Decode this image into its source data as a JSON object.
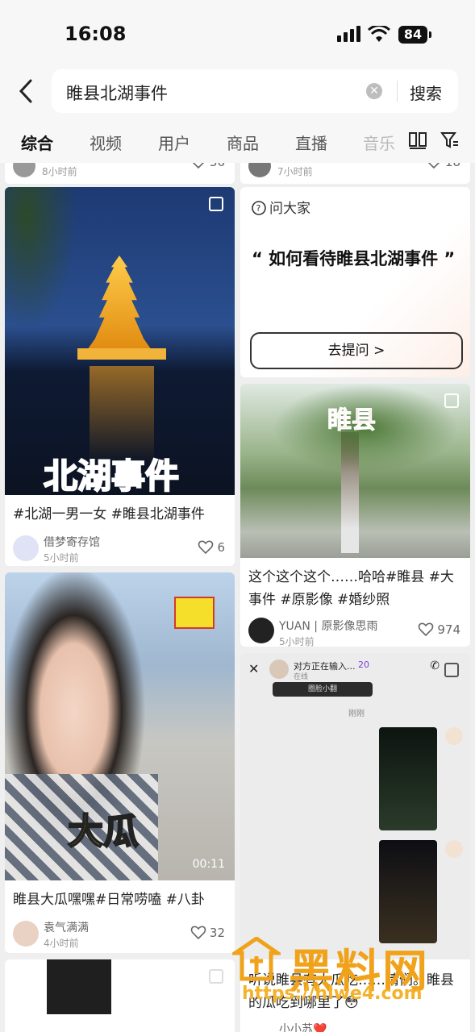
{
  "status": {
    "time": "16:08",
    "battery": "84"
  },
  "header": {
    "query": "睢县北湖事件",
    "search_label": "搜索"
  },
  "tabs": [
    "综合",
    "视频",
    "用户",
    "商品",
    "直播",
    "音乐"
  ],
  "top_row": {
    "left_time": "8小时前",
    "left_likes": "36",
    "right_time": "7小时前",
    "right_likes": "18"
  },
  "card1": {
    "overlay": "北湖事件",
    "desc": "#北湖一男一女 #睢县北湖事件",
    "author": "借梦寄存馆",
    "time": "5小时前",
    "likes": "6"
  },
  "ask": {
    "label": "问大家",
    "question": "“ 如何看待睢县北湖事件 ”",
    "button": "去提问 >"
  },
  "card2": {
    "overlay": "睢县",
    "desc": "这个这个这个……哈哈#睢县 #大事件 #原影像 #婚纱照",
    "author": "YUAN | 原影像思雨",
    "time": "5小时前",
    "likes": "974"
  },
  "card3": {
    "overlay": "大瓜",
    "duration": "00:11",
    "desc": "睢县大瓜嘿嘿#日常唠嗑 #八卦",
    "author": "袁气满满",
    "time": "4小时前",
    "likes": "32"
  },
  "chat_card": {
    "contact": "对方正在输入...",
    "badge": "20",
    "online": "在线",
    "bubble": "圈脸小翻",
    "time_label": "刚刚",
    "desc": "听说睢县有大瓜吃……请们。睢县的瓜吃到哪里了😳",
    "author": "小小苏❤️"
  },
  "watermark": {
    "main": "黑料网",
    "url": "https://hlwe4.com"
  },
  "colors": {
    "accent": "#f0a21a",
    "text": "#222222",
    "muted": "#999999"
  }
}
